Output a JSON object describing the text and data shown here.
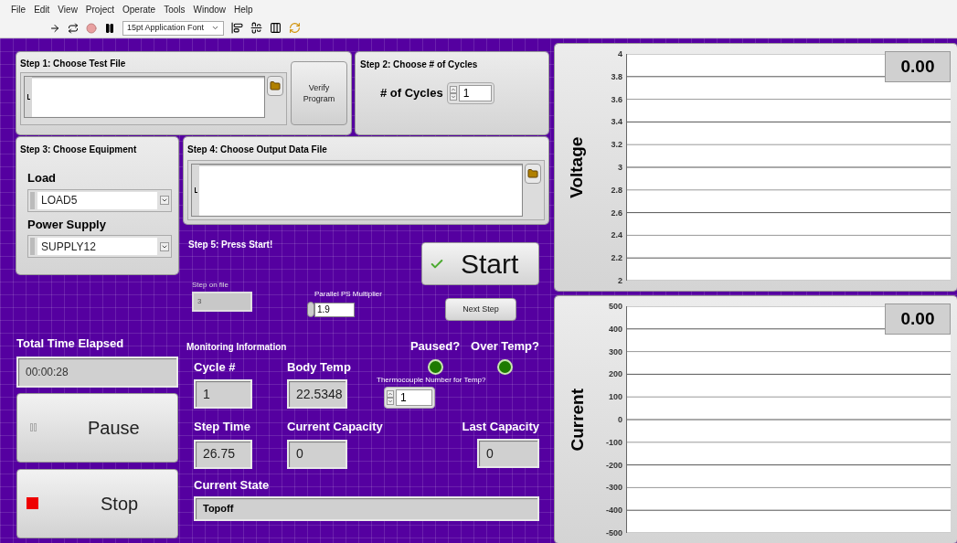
{
  "menu": [
    "File",
    "Edit",
    "View",
    "Project",
    "Operate",
    "Tools",
    "Window",
    "Help"
  ],
  "toolbar": {
    "font": "15pt Application Font"
  },
  "step1": {
    "title": "Step 1: Choose Test File",
    "button": "Verify Program"
  },
  "step2": {
    "title": "Step 2: Choose # of Cycles",
    "label": "# of Cycles",
    "value": "1"
  },
  "step3": {
    "title": "Step 3: Choose Equipment",
    "selects": [
      {
        "label": "Load",
        "value": "LOAD5"
      },
      {
        "label": "Power Supply",
        "value": "SUPPLY12"
      }
    ]
  },
  "step4": {
    "title": "Step 4: Choose Output Data File"
  },
  "step5": {
    "title": "Step 5: Press Start!",
    "start": "Start",
    "step_on_file": {
      "label": "Step on file",
      "value": "3"
    },
    "multiplier": {
      "label": "Parallel PS Multiplier",
      "value": "1.9"
    },
    "next": "Next Step"
  },
  "total_time": {
    "label": "Total Time Elapsed",
    "value": "00:00:28"
  },
  "pause": {
    "label": "Pause",
    "pressed": false
  },
  "stop": {
    "label": "Stop",
    "pressed": false
  },
  "monitoring": {
    "title": "Monitoring Information",
    "leds": [
      {
        "label": "Paused?",
        "on": false
      },
      {
        "label": "Over Temp?",
        "on": false
      }
    ],
    "col1": [
      {
        "label": "Cycle #",
        "value": "1"
      },
      {
        "label": "Step Time",
        "value": "26.75"
      }
    ],
    "col2": [
      {
        "label": "Body Temp",
        "value": "22.5348"
      },
      {
        "label": "Current Capacity",
        "value": "0"
      }
    ],
    "thermocouple": {
      "label": "Thermocouple Number for Temp?",
      "value": "1"
    },
    "last_capacity": {
      "label": "Last Capacity",
      "value": "0"
    },
    "current_state": {
      "label": "Current State",
      "value": "Topoff"
    }
  },
  "charts": [
    {
      "display": "0.00",
      "ylabel": "Voltage",
      "tick_labels": [
        "4",
        "3.8",
        "3.6",
        "3.4",
        "3.2",
        "3",
        "2.8",
        "2.6",
        "2.4",
        "2.2",
        "2"
      ]
    },
    {
      "display": "0.00",
      "ylabel": "Current",
      "tick_labels": [
        "500",
        "400",
        "300",
        "200",
        "100",
        "0",
        "-100",
        "-200",
        "-300",
        "-400",
        "-500"
      ]
    }
  ]
}
